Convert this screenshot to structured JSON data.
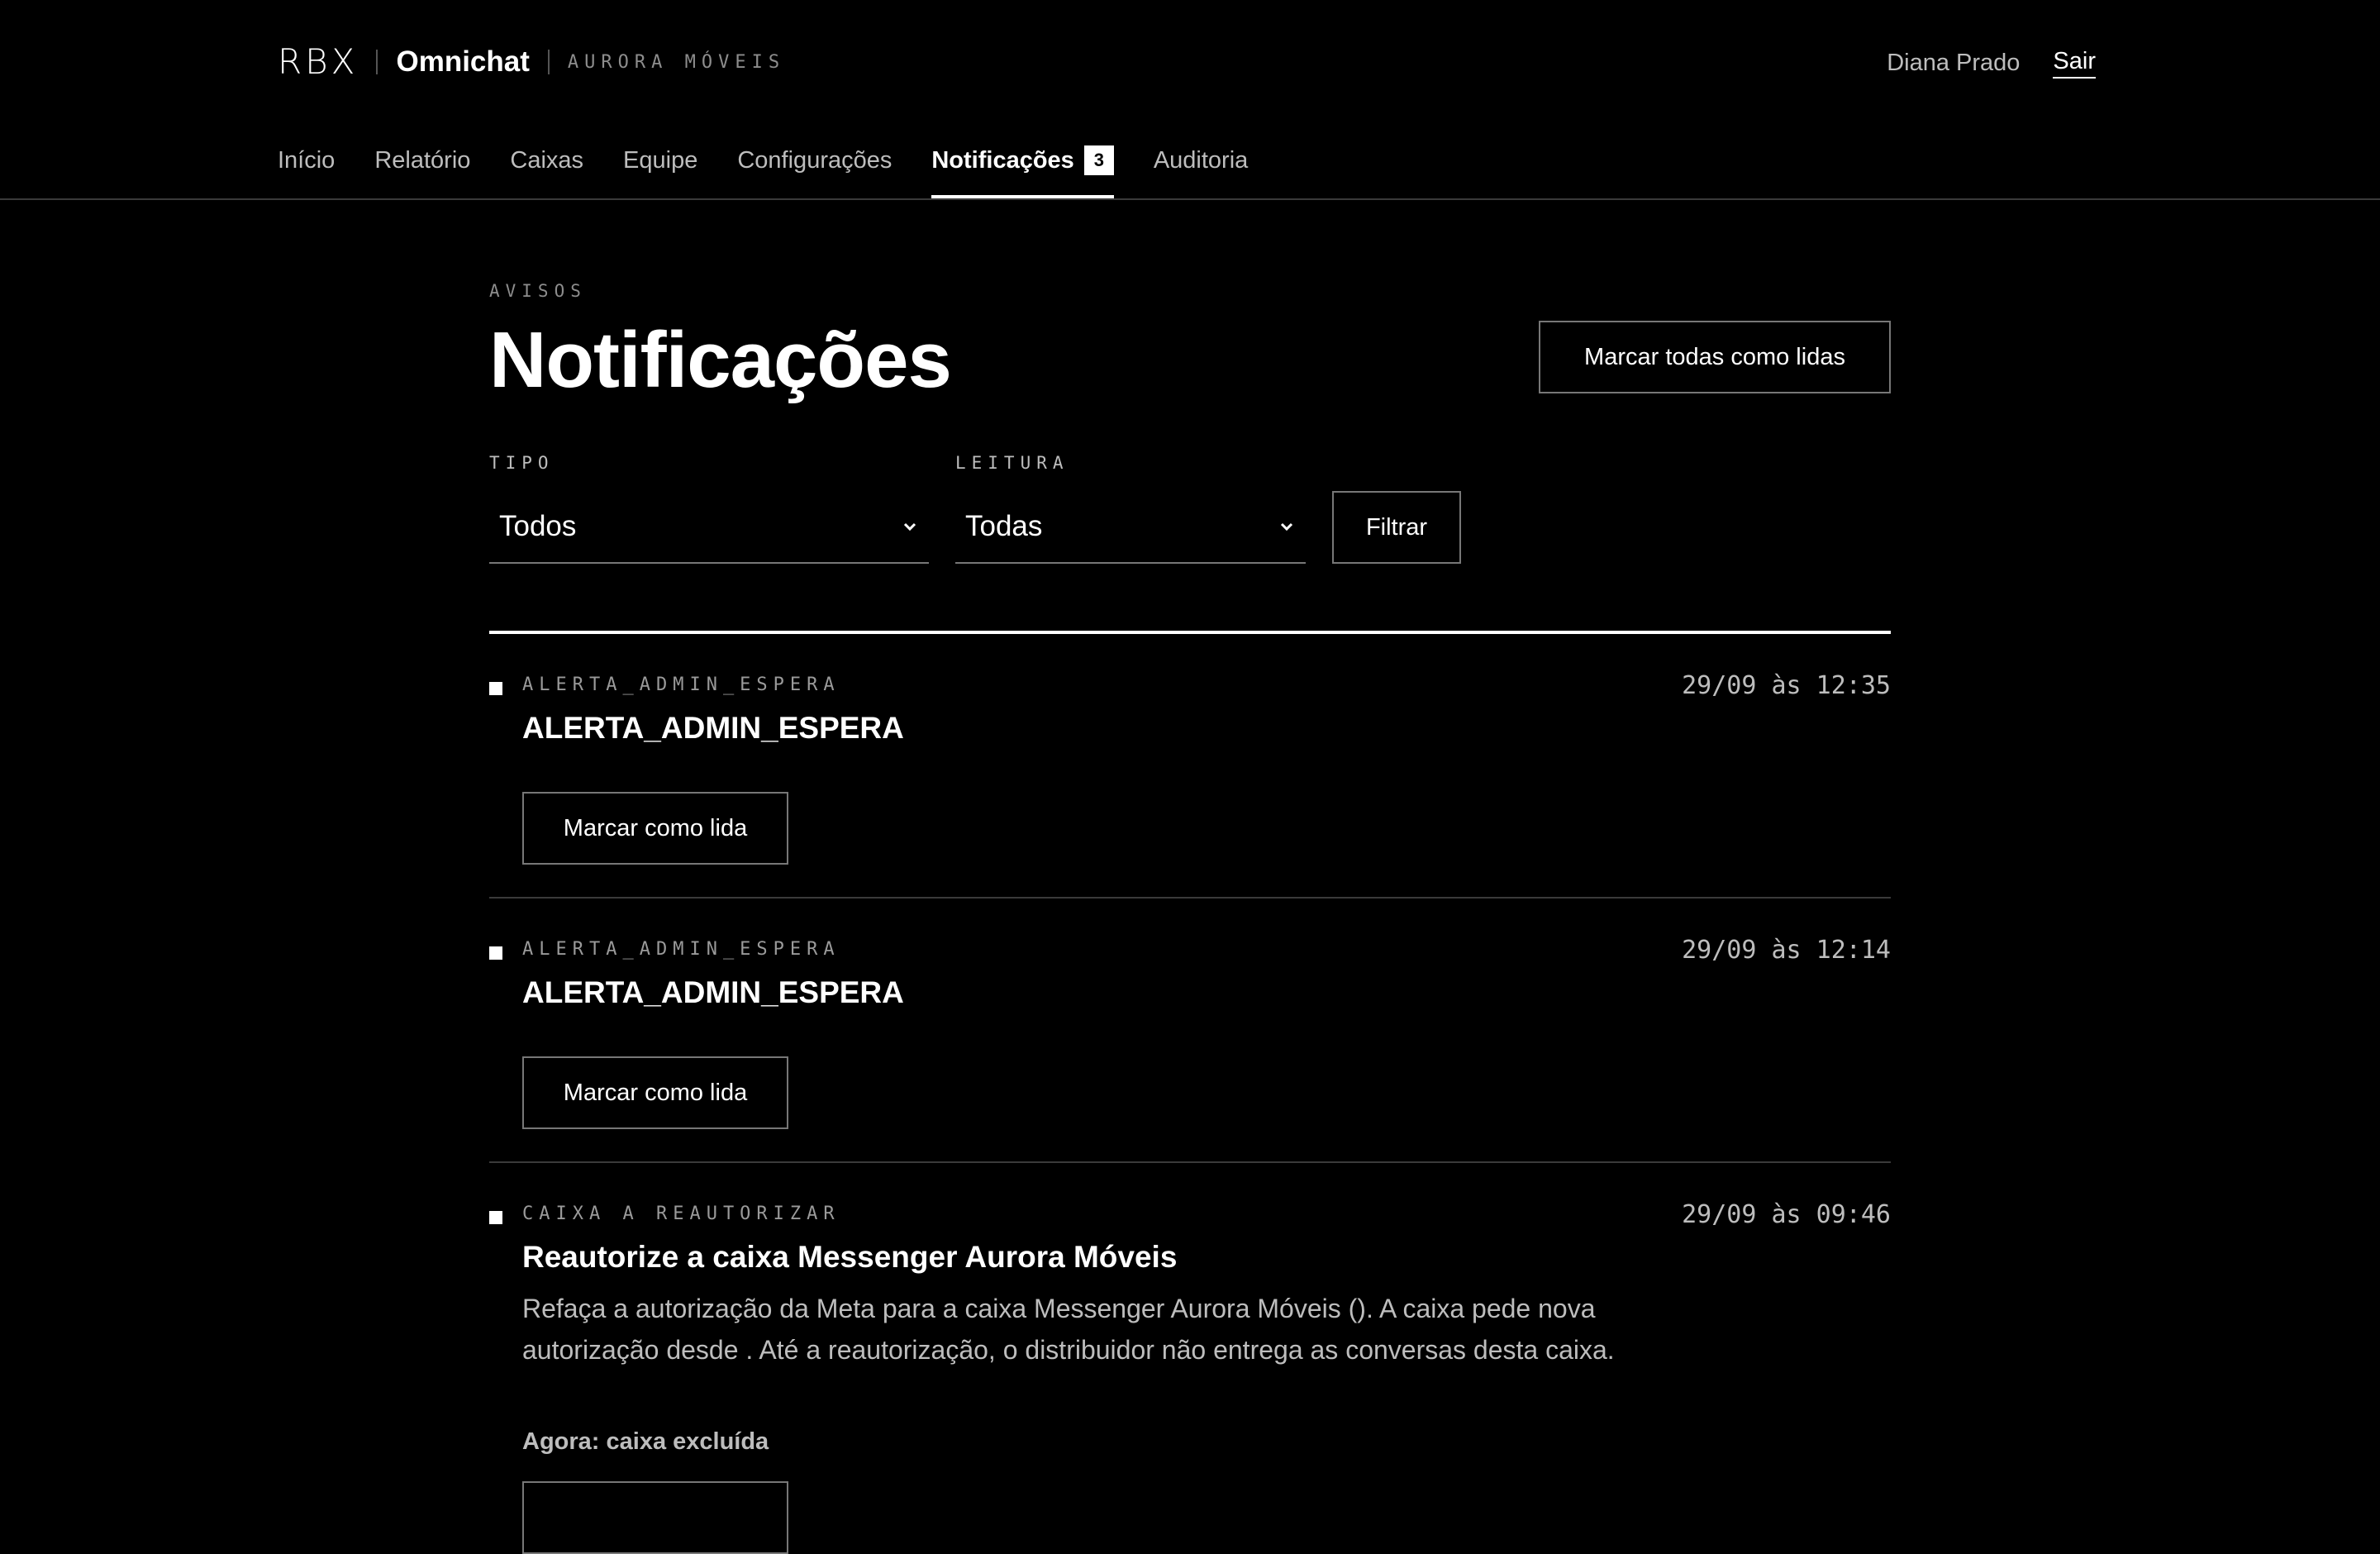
{
  "header": {
    "logo": "RBX",
    "product": "Omnichat",
    "company": "AURORA MÓVEIS",
    "user_name": "Diana Prado",
    "logout_label": "Sair"
  },
  "nav": {
    "tabs": [
      {
        "label": "Início"
      },
      {
        "label": "Relatório"
      },
      {
        "label": "Caixas"
      },
      {
        "label": "Equipe"
      },
      {
        "label": "Configurações"
      },
      {
        "label": "Notificações",
        "badge": "3",
        "active": true
      },
      {
        "label": "Auditoria"
      }
    ]
  },
  "page": {
    "eyebrow": "AVISOS",
    "title": "Notificações",
    "mark_all_label": "Marcar todas como lidas"
  },
  "filters": {
    "type_label": "TIPO",
    "type_value": "Todos",
    "read_label": "LEITURA",
    "read_value": "Todas",
    "submit_label": "Filtrar"
  },
  "notifications": [
    {
      "kind": "ALERTA_ADMIN_ESPERA",
      "time": "29/09 às 12:35",
      "title": "ALERTA_ADMIN_ESPERA",
      "action_label": "Marcar como lida"
    },
    {
      "kind": "ALERTA_ADMIN_ESPERA",
      "time": "29/09 às 12:14",
      "title": "ALERTA_ADMIN_ESPERA",
      "action_label": "Marcar como lida"
    },
    {
      "kind": "CAIXA A REAUTORIZAR",
      "time": "29/09 às 09:46",
      "title": "Reautorize a caixa Messenger Aurora Móveis",
      "body": "Refaça a autorização da Meta para a caixa Messenger Aurora Móveis (). A caixa pede nova autorização desde . Até a reautorização, o distribuidor não entrega as conversas desta caixa.",
      "status": "Agora: caixa excluída"
    }
  ],
  "colors": {
    "background": "#000000",
    "text": "#ffffff",
    "muted": "#bdbdbd",
    "border": "#777777"
  }
}
